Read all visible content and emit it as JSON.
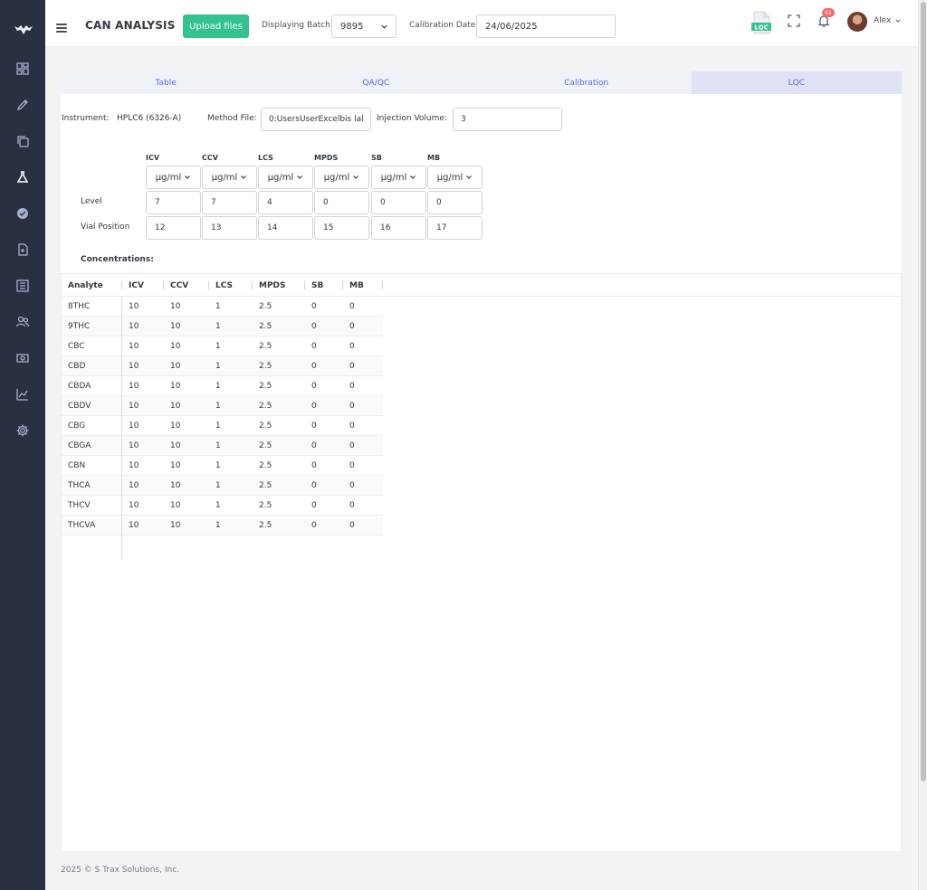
{
  "sidebar": {
    "logo": "brand-logo",
    "items": [
      {
        "name": "dashboard-icon"
      },
      {
        "name": "pencil-icon"
      },
      {
        "name": "copy-icon"
      },
      {
        "name": "flask-icon",
        "active": true
      },
      {
        "name": "badge-check-icon"
      },
      {
        "name": "file-icon"
      },
      {
        "name": "list-icon"
      },
      {
        "name": "users-icon"
      },
      {
        "name": "money-icon"
      },
      {
        "name": "chart-icon"
      },
      {
        "name": "settings-icon"
      }
    ]
  },
  "header": {
    "title": "CAN ANALYSIS",
    "upload_label": "Upload files",
    "batch_label": "Displaying Batch:",
    "batch_value": "9895",
    "calibration_label": "Calibration Date:",
    "calibration_value": "24/06/2025",
    "lqc_badge": "LQC",
    "notification_count": "61",
    "user_name": "Alex"
  },
  "tabs": [
    "Table",
    "QA/QC",
    "Calibration",
    "LQC"
  ],
  "active_tab": "LQC",
  "instrument": {
    "label": "Instrument:",
    "value": "HPLC6 (6326-A)",
    "method_label": "Method File:",
    "method_value": "0:UsersUserExcelbis lal",
    "injection_label": "Injection Volume:",
    "injection_value": "3"
  },
  "grid": {
    "columns": [
      "ICV",
      "CCV",
      "LCS",
      "MPDS",
      "SB",
      "MB"
    ],
    "unit": "µg/ml",
    "level_label": "Level",
    "levels": [
      "7",
      "7",
      "4",
      "0",
      "0",
      "0"
    ],
    "vial_label": "Vial Position",
    "vials": [
      "12",
      "13",
      "14",
      "15",
      "16",
      "17"
    ]
  },
  "concentrations": {
    "label": "Concentrations:",
    "headers": [
      "Analyte",
      "ICV",
      "CCV",
      "LCS",
      "MPDS",
      "SB",
      "MB"
    ],
    "rows": [
      [
        "8THC",
        "10",
        "10",
        "1",
        "2.5",
        "0",
        "0"
      ],
      [
        "9THC",
        "10",
        "10",
        "1",
        "2.5",
        "0",
        "0"
      ],
      [
        "CBC",
        "10",
        "10",
        "1",
        "2.5",
        "0",
        "0"
      ],
      [
        "CBD",
        "10",
        "10",
        "1",
        "2.5",
        "0",
        "0"
      ],
      [
        "CBDA",
        "10",
        "10",
        "1",
        "2.5",
        "0",
        "0"
      ],
      [
        "CBDV",
        "10",
        "10",
        "1",
        "2.5",
        "0",
        "0"
      ],
      [
        "CBG",
        "10",
        "10",
        "1",
        "2.5",
        "0",
        "0"
      ],
      [
        "CBGA",
        "10",
        "10",
        "1",
        "2.5",
        "0",
        "0"
      ],
      [
        "CBN",
        "10",
        "10",
        "1",
        "2.5",
        "0",
        "0"
      ],
      [
        "THCA",
        "10",
        "10",
        "1",
        "2.5",
        "0",
        "0"
      ],
      [
        "THCV",
        "10",
        "10",
        "1",
        "2.5",
        "0",
        "0"
      ],
      [
        "THCVA",
        "10",
        "10",
        "1",
        "2.5",
        "0",
        "0"
      ]
    ]
  },
  "footer": "2025 © S Trax Solutions, Inc.",
  "colors": {
    "sidebar": "#2a3042",
    "accent": "#556ee6",
    "success": "#34c38f",
    "danger": "#f46a6a"
  }
}
